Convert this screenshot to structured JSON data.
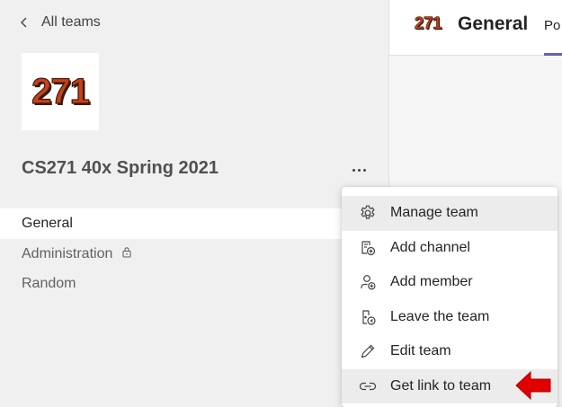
{
  "nav": {
    "back_label": "All teams"
  },
  "team": {
    "logo_text": "271",
    "name": "CS271 40x Spring 2021"
  },
  "channels": [
    {
      "label": "General"
    },
    {
      "label": "Administration"
    },
    {
      "label": "Random"
    }
  ],
  "header": {
    "logo_text": "271",
    "channel_title": "General",
    "tab_posts": "Po"
  },
  "menu": {
    "items": [
      {
        "label": "Manage team",
        "icon": "gear-icon"
      },
      {
        "label": "Add channel",
        "icon": "add-channel-icon"
      },
      {
        "label": "Add member",
        "icon": "add-member-icon"
      },
      {
        "label": "Leave the team",
        "icon": "leave-team-icon"
      },
      {
        "label": "Edit team",
        "icon": "pencil-icon"
      },
      {
        "label": "Get link to team",
        "icon": "link-icon"
      }
    ]
  },
  "colors": {
    "accent": "#6264a7",
    "annotation_arrow": "#e00000"
  }
}
